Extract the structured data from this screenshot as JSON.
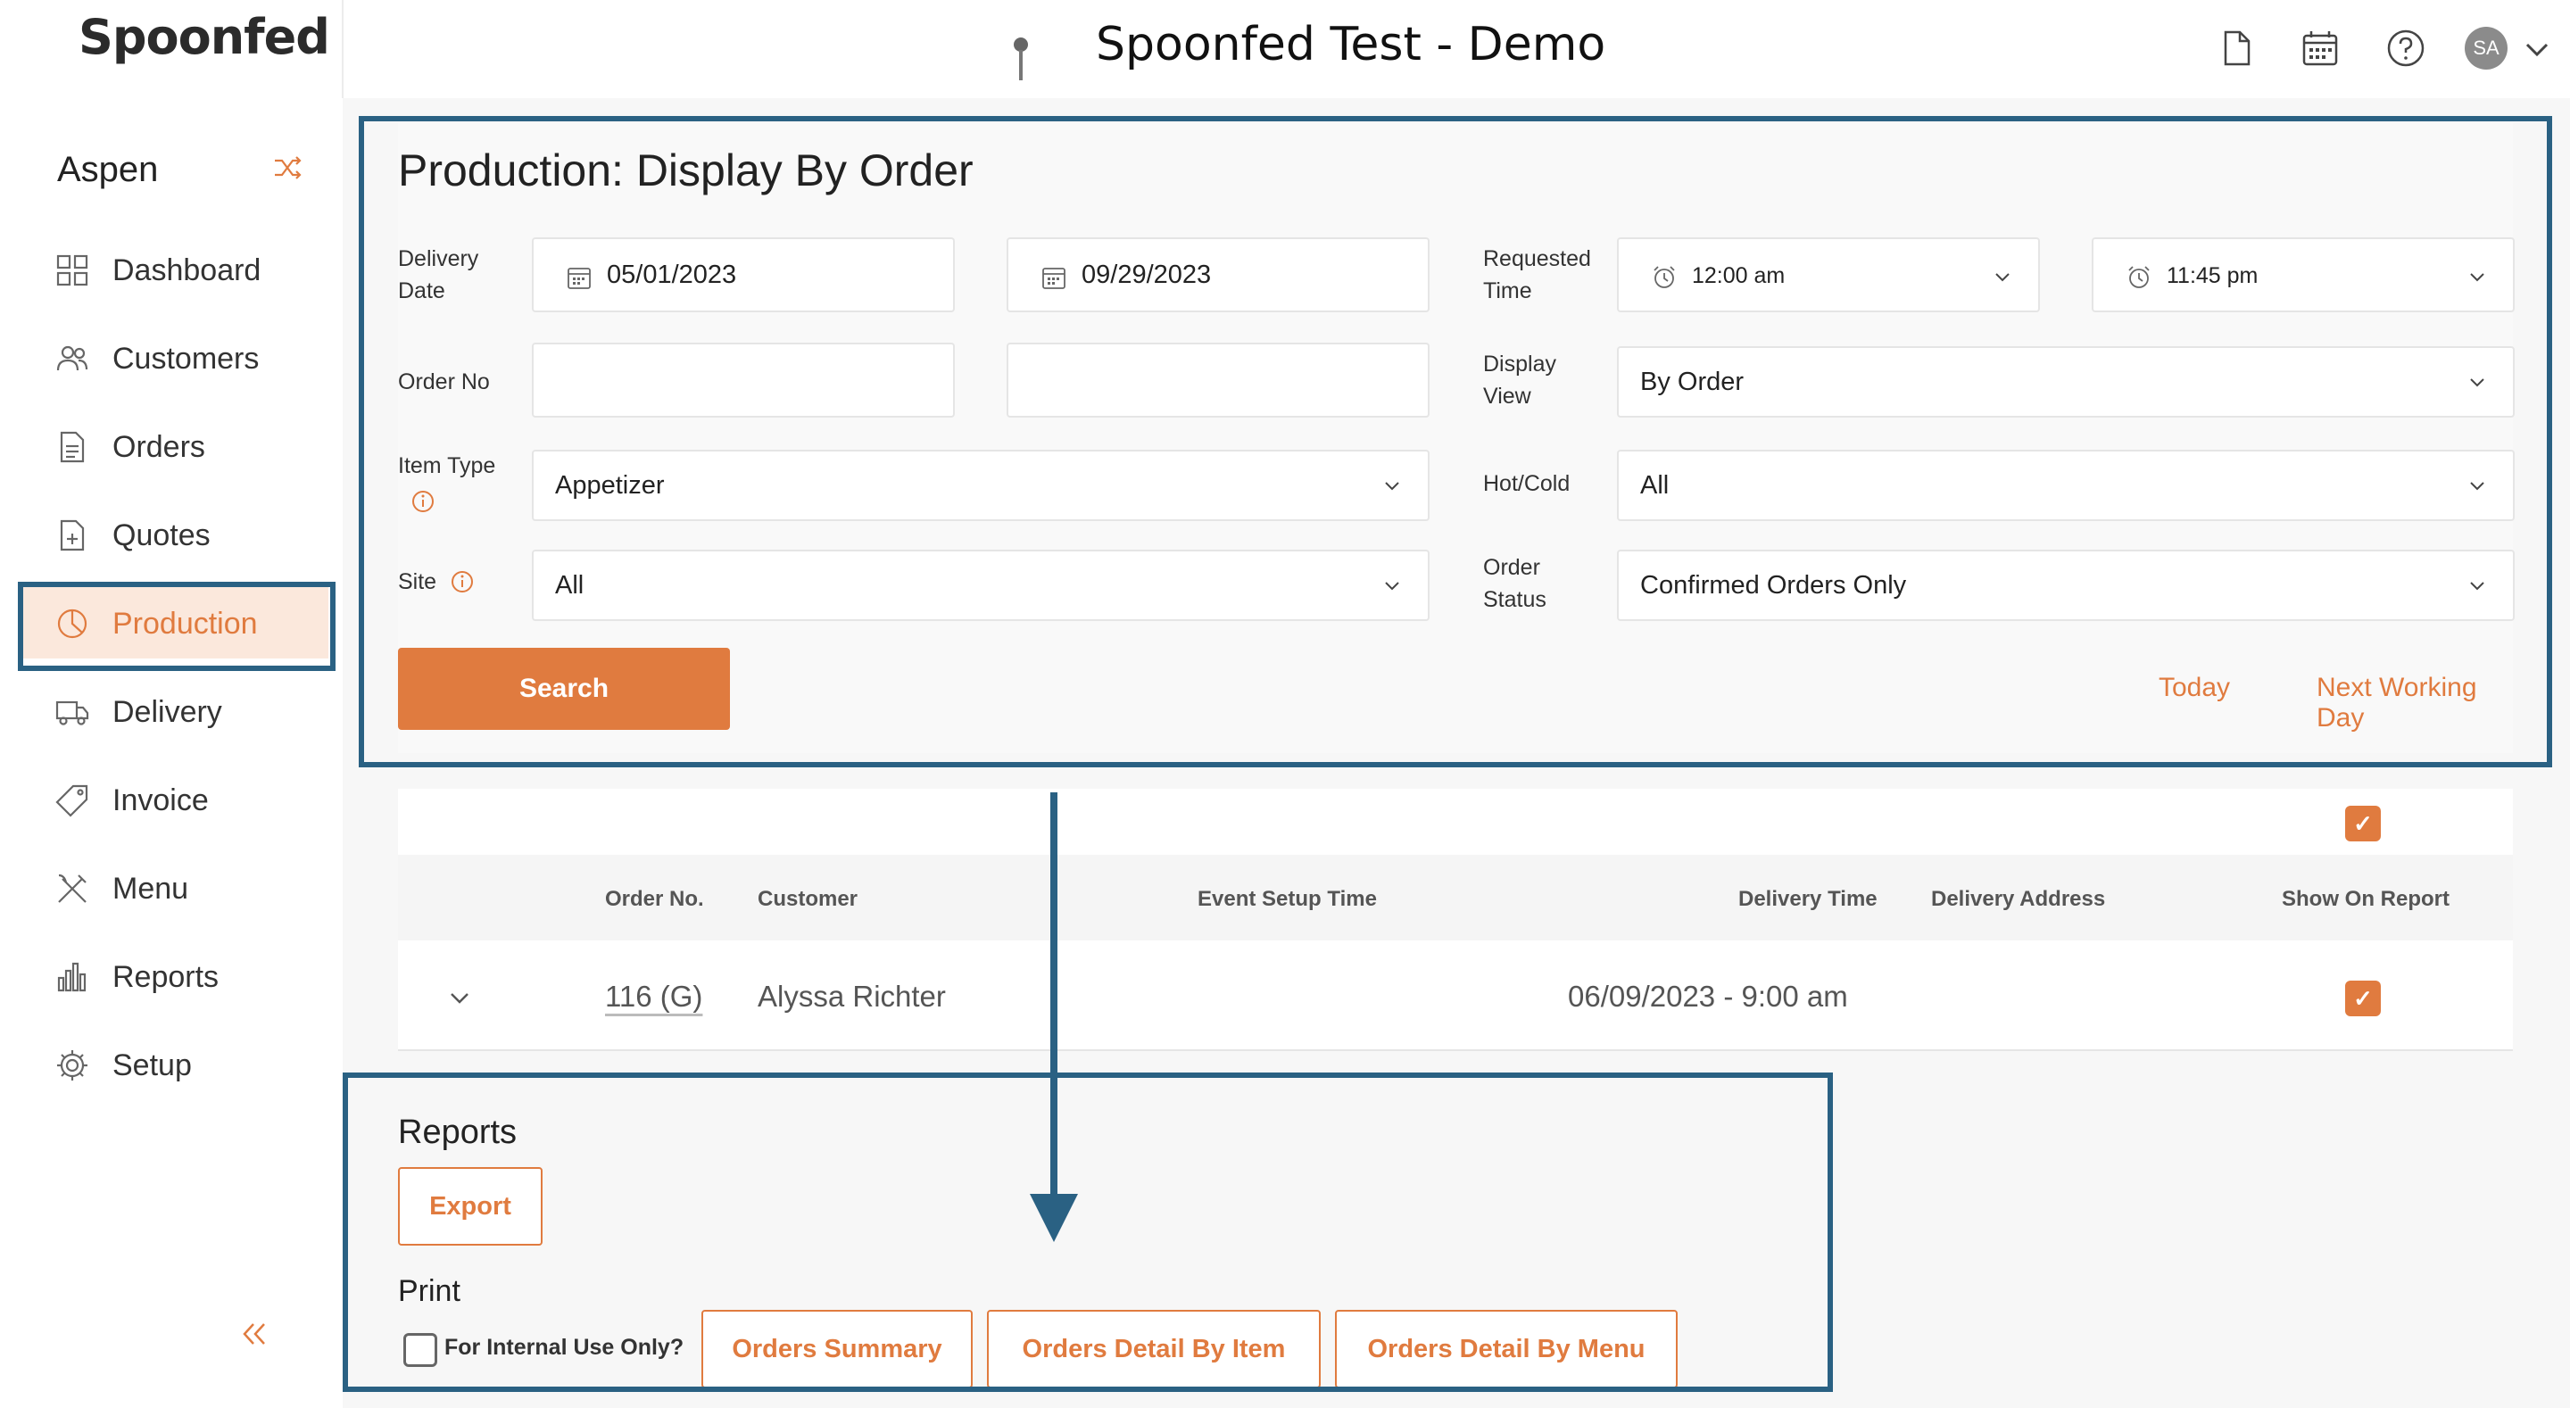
{
  "header": {
    "logo": "Spoonfed",
    "title": "Spoonfed Test - Demo",
    "avatar_initials": "SA"
  },
  "sidebar": {
    "site": "Aspen",
    "items": [
      {
        "label": "Dashboard",
        "icon": "grid-icon"
      },
      {
        "label": "Customers",
        "icon": "users-icon"
      },
      {
        "label": "Orders",
        "icon": "document-icon"
      },
      {
        "label": "Quotes",
        "icon": "document-plus-icon"
      },
      {
        "label": "Production",
        "icon": "pie-chart-icon",
        "active": true
      },
      {
        "label": "Delivery",
        "icon": "truck-icon"
      },
      {
        "label": "Invoice",
        "icon": "tag-icon"
      },
      {
        "label": "Menu",
        "icon": "utensils-icon"
      },
      {
        "label": "Reports",
        "icon": "bar-chart-icon"
      },
      {
        "label": "Setup",
        "icon": "gear-icon"
      }
    ]
  },
  "form": {
    "title": "Production: Display By Order",
    "delivery_date_label": "Delivery Date",
    "delivery_date_from": "05/01/2023",
    "delivery_date_to": "09/29/2023",
    "requested_time_label": "Requested Time",
    "requested_time_from": "12:00 am",
    "requested_time_to": "11:45 pm",
    "order_no_label": "Order No",
    "order_no_from": "",
    "order_no_to": "",
    "display_view_label": "Display View",
    "display_view": "By Order",
    "item_type_label": "Item Type",
    "item_type": "Appetizer",
    "hot_cold_label": "Hot/Cold",
    "hot_cold": "All",
    "site_label": "Site",
    "site": "All",
    "order_status_label": "Order Status",
    "order_status": "Confirmed Orders Only",
    "search_label": "Search",
    "today_label": "Today",
    "next_working_day_label": "Next Working Day"
  },
  "table": {
    "columns": [
      "Order No.",
      "Customer",
      "Event Setup Time",
      "Delivery Time",
      "Delivery Address",
      "Show On Report"
    ],
    "rows": [
      {
        "order_no": "116 (G)",
        "customer": "Alyssa Richter",
        "event_setup_time": "",
        "delivery_time": "06/09/2023 - 9:00 am",
        "delivery_address": "",
        "show_on_report": true
      }
    ]
  },
  "reports": {
    "title": "Reports",
    "export_label": "Export",
    "print_title": "Print",
    "internal_use_label": "For Internal Use Only?",
    "orders_summary_label": "Orders Summary",
    "orders_detail_item_label": "Orders Detail By Item",
    "orders_detail_menu_label": "Orders Detail By Menu"
  },
  "colors": {
    "accent": "#e07b3f",
    "highlight": "#2a6183",
    "active_bg": "#fbe8dc"
  }
}
